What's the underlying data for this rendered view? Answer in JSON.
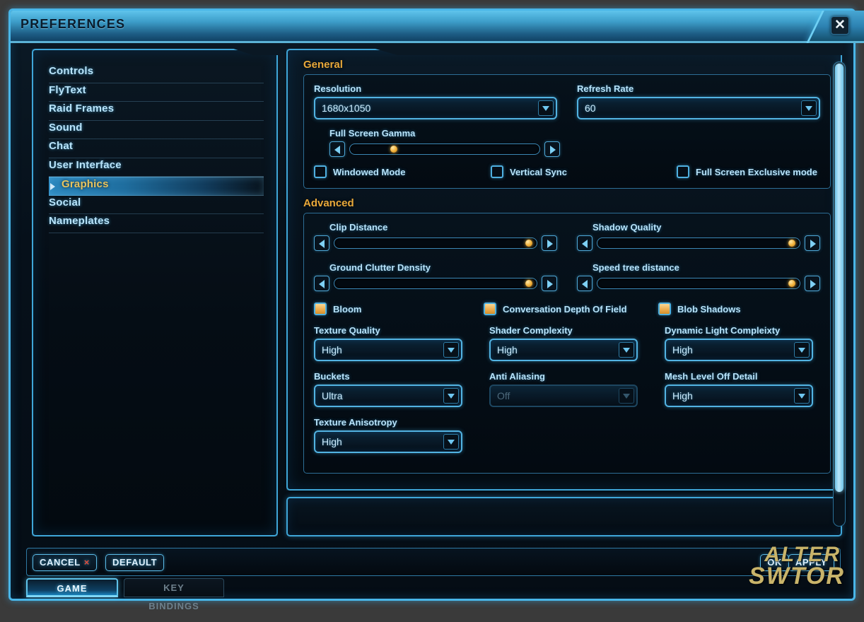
{
  "window": {
    "title": "PREFERENCES",
    "close_icon": "close-icon",
    "close_glyph": "✕"
  },
  "colors": {
    "accent_cyan": "#49b6e8",
    "section_heading": "#e9a93a",
    "selected_nav_text": "#e8c45f",
    "slider_handle": "#f0ae36",
    "checkbox_checked": "#eeb255",
    "cancel_x": "#e24b3a",
    "watermark": "#c9b46a"
  },
  "sidebar": {
    "items": [
      {
        "label": "Controls",
        "selected": false
      },
      {
        "label": "FlyText",
        "selected": false
      },
      {
        "label": "Raid Frames",
        "selected": false
      },
      {
        "label": "Sound",
        "selected": false
      },
      {
        "label": "Chat",
        "selected": false
      },
      {
        "label": "User Interface",
        "selected": false
      },
      {
        "label": "Graphics",
        "selected": true
      },
      {
        "label": "Social",
        "selected": false
      },
      {
        "label": "Nameplates",
        "selected": false
      }
    ]
  },
  "general": {
    "heading": "General",
    "resolution": {
      "label": "Resolution",
      "value": "1680x1050",
      "enabled": true
    },
    "refresh_rate": {
      "label": "Refresh Rate",
      "value": "60",
      "enabled": true
    },
    "full_screen_gamma": {
      "label": "Full Screen Gamma",
      "percent": 23
    },
    "checkboxes": [
      {
        "label": "Windowed Mode",
        "checked": false
      },
      {
        "label": "Vertical Sync",
        "checked": false
      },
      {
        "label": "Full Screen Exclusive mode",
        "checked": false
      }
    ]
  },
  "advanced": {
    "heading": "Advanced",
    "sliders": [
      {
        "label": "Clip Distance",
        "percent": 96
      },
      {
        "label": "Shadow Quality",
        "percent": 96
      },
      {
        "label": "Ground Clutter Density",
        "percent": 96
      },
      {
        "label": "Speed tree distance",
        "percent": 96
      }
    ],
    "checkboxes": [
      {
        "label": "Bloom",
        "checked": true
      },
      {
        "label": "Conversation Depth Of Field",
        "checked": true
      },
      {
        "label": "Blob Shadows",
        "checked": true
      }
    ],
    "dropdowns": [
      {
        "label": "Texture Quality",
        "value": "High",
        "enabled": true
      },
      {
        "label": "Shader Complexity",
        "value": "High",
        "enabled": true
      },
      {
        "label": "Dynamic Light Compleixty",
        "value": "High",
        "enabled": true
      },
      {
        "label": "Buckets",
        "value": "Ultra",
        "enabled": true
      },
      {
        "label": "Anti Aliasing",
        "value": "Off",
        "enabled": false
      },
      {
        "label": "Mesh Level Off Detail",
        "value": "High",
        "enabled": true
      },
      {
        "label": "Texture Anisotropy",
        "value": "High",
        "enabled": true
      }
    ]
  },
  "footer": {
    "cancel_label": "CANCEL",
    "cancel_x": "×",
    "default_label": "DEFAULT",
    "ok_label": "OK",
    "apply_label": "APPLY"
  },
  "tabs": [
    {
      "label": "GAME",
      "active": true
    },
    {
      "label": "KEY BINDINGS",
      "active": false
    }
  ],
  "watermark": {
    "line1": "ALTER",
    "line2": "SWTOR"
  },
  "scrollbar": {
    "thumb_percent": 93
  }
}
